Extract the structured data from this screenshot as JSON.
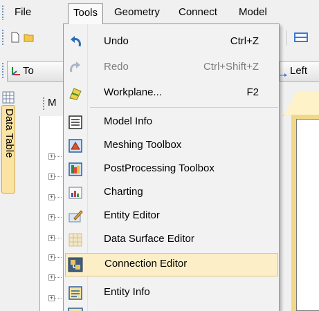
{
  "menubar": {
    "items": [
      {
        "label": "File"
      },
      {
        "label": "Tools",
        "open": true
      },
      {
        "label": "Geometry"
      },
      {
        "label": "Connect"
      },
      {
        "label": "Model"
      }
    ]
  },
  "toolbar": {
    "to_button_label": "To",
    "left_button_label": "Left"
  },
  "left_panel": {
    "vertical_tab_label": "Data Table",
    "panel_header_label": "M"
  },
  "tools_menu": {
    "items": [
      {
        "label": "Undo",
        "shortcut": "Ctrl+Z",
        "icon": "undo-icon",
        "enabled": true
      },
      {
        "label": "Redo",
        "shortcut": "Ctrl+Shift+Z",
        "icon": "redo-icon",
        "enabled": false
      },
      {
        "label": "Workplane...",
        "shortcut": "F2",
        "icon": "workplane-icon",
        "enabled": true
      },
      {
        "label": "Model Info",
        "icon": "model-info-icon",
        "enabled": true
      },
      {
        "label": "Meshing Toolbox",
        "icon": "meshing-toolbox-icon",
        "enabled": true
      },
      {
        "label": "PostProcessing Toolbox",
        "icon": "postprocessing-toolbox-icon",
        "enabled": true
      },
      {
        "label": "Charting",
        "icon": "chart-icon",
        "enabled": true
      },
      {
        "label": "Entity Editor",
        "icon": "entity-editor-icon",
        "enabled": true
      },
      {
        "label": "Data Surface Editor",
        "icon": "data-surface-grid-icon",
        "enabled": true
      },
      {
        "label": "Connection Editor",
        "icon": "connection-editor-icon",
        "enabled": true,
        "highlighted": true
      },
      {
        "label": "Entity Info",
        "icon": "entity-info-icon",
        "enabled": true
      }
    ]
  },
  "colors": {
    "highlight_bg": "#fcefc7",
    "highlight_border": "#e5c365",
    "disabled_text": "#7d7d7d",
    "tab_bg": "#fbe3a4"
  }
}
